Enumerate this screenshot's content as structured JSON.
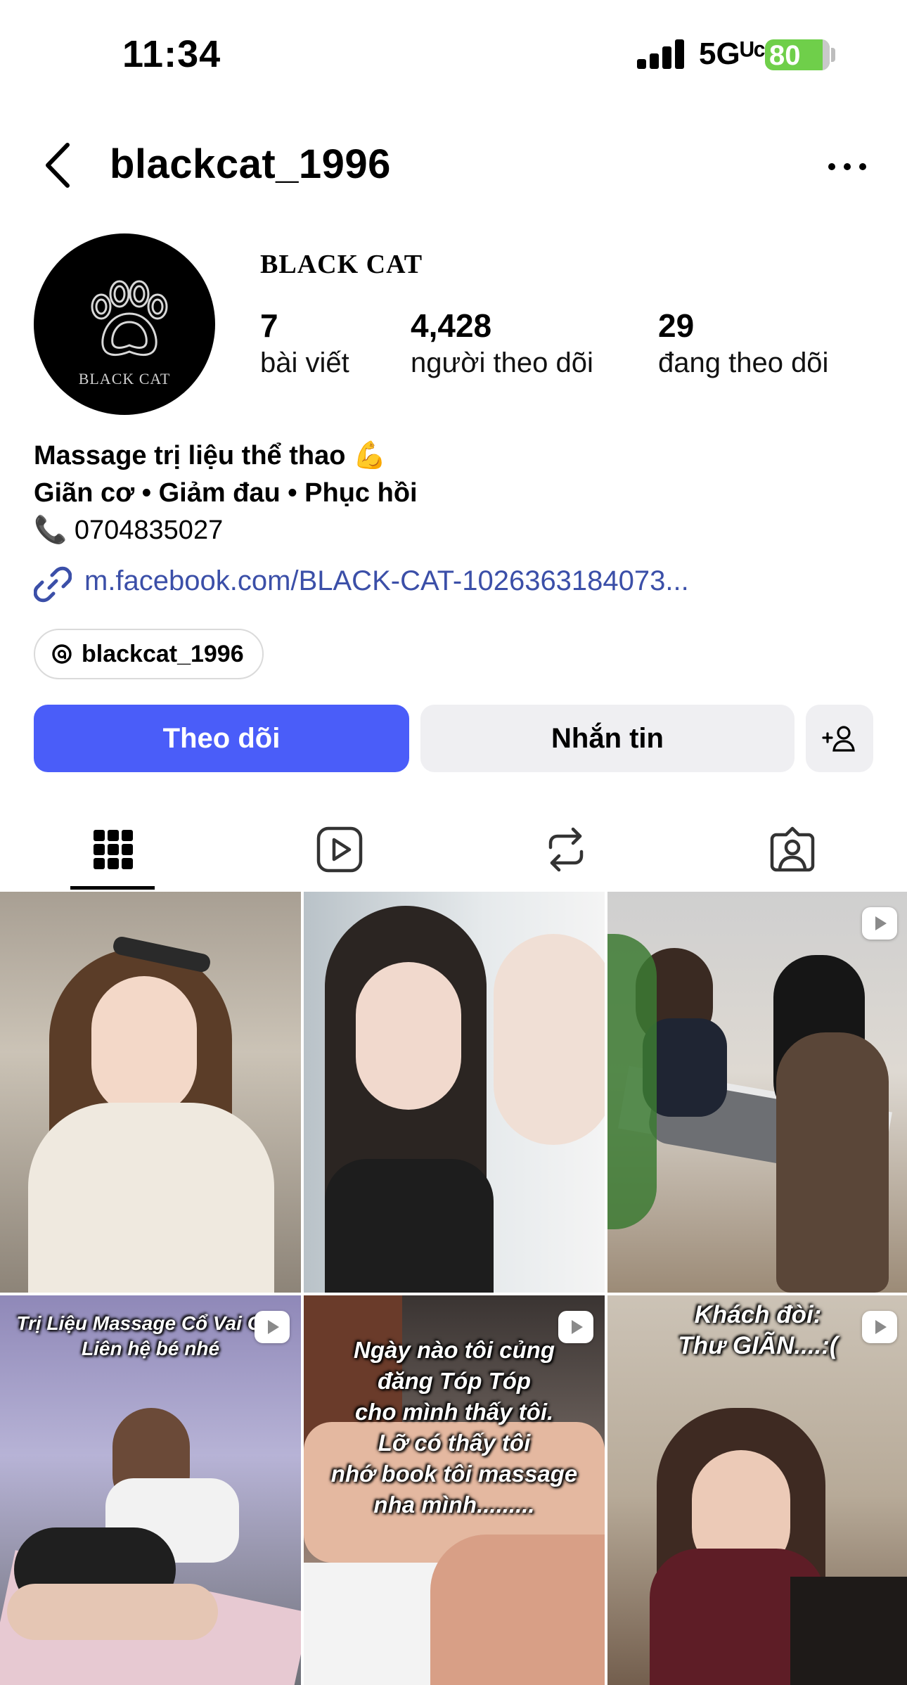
{
  "status_bar": {
    "time": "11:34",
    "network": "5Gᵁᶜ",
    "battery": "80"
  },
  "header": {
    "username": "blackcat_1996"
  },
  "profile": {
    "avatar_text": "BLACK CAT",
    "display_name": "BLACK CAT",
    "stats": [
      {
        "value": "7",
        "label": "bài viết"
      },
      {
        "value": "4,428",
        "label": "người theo dõi"
      },
      {
        "value": "29",
        "label": "đang theo dõi"
      }
    ],
    "bio": {
      "line1": "Massage trị liệu thể thao 💪",
      "line2": "Giãn cơ • Giảm đau • Phục hồi",
      "line3": "📞 0704835027"
    },
    "link": "m.facebook.com/BLACK-CAT-1026363184073...",
    "threads_handle": "blackcat_1996"
  },
  "actions": {
    "follow": "Theo dõi",
    "message": "Nhắn tin"
  },
  "posts": [
    {
      "reel": false,
      "overlay": ""
    },
    {
      "reel": false,
      "overlay": ""
    },
    {
      "reel": true,
      "overlay": ""
    },
    {
      "reel": true,
      "overlay": "Trị Liệu Massage Cổ Vai Gáy\nLiên hệ bé nhé"
    },
    {
      "reel": true,
      "overlay": "Ngày nào tôi củng\nđăng Tóp Tóp\ncho mình thấy tôi.\nLỡ có thấy tôi\nnhớ book tôi massage\nnha mình........."
    },
    {
      "reel": true,
      "overlay": "Khách đòi:\nThư GIÃN....:("
    }
  ],
  "colors": {
    "follow_button": "#4a5df9",
    "secondary_button": "#efeff2",
    "link": "#3b4fa8",
    "battery": "#6fcf4a"
  }
}
